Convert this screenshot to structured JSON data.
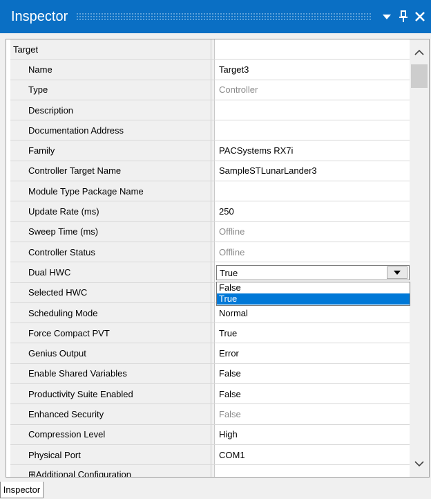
{
  "window": {
    "title": "Inspector",
    "icons": [
      "dropdown-arrow-icon",
      "pin-icon",
      "close-icon"
    ]
  },
  "grid": {
    "category": "Target",
    "rows": [
      {
        "name": "Name",
        "value": "Target3",
        "readonly": false
      },
      {
        "name": "Type",
        "value": "Controller",
        "readonly": true
      },
      {
        "name": "Description",
        "value": "",
        "readonly": false
      },
      {
        "name": "Documentation Address",
        "value": "",
        "readonly": false
      },
      {
        "name": "Family",
        "value": "PACSystems RX7i",
        "readonly": false
      },
      {
        "name": "Controller Target Name",
        "value": "SampleSTLunarLander3",
        "readonly": false
      },
      {
        "name": "Module Type Package Name",
        "value": "",
        "readonly": false
      },
      {
        "name": "Update Rate (ms)",
        "value": "250",
        "readonly": false
      },
      {
        "name": "Sweep Time (ms)",
        "value": "Offline",
        "readonly": true
      },
      {
        "name": "Controller Status",
        "value": "Offline",
        "readonly": true
      },
      {
        "name": "Dual HWC",
        "value": "True",
        "readonly": false,
        "editor": "combo"
      },
      {
        "name": "Selected HWC",
        "value": "",
        "readonly": false
      },
      {
        "name": "Scheduling Mode",
        "value": "Normal",
        "readonly": false
      },
      {
        "name": "Force Compact PVT",
        "value": "True",
        "readonly": false
      },
      {
        "name": "Genius Output",
        "value": "Error",
        "readonly": false
      },
      {
        "name": "Enable Shared Variables",
        "value": "False",
        "readonly": false
      },
      {
        "name": "Productivity Suite Enabled",
        "value": "False",
        "readonly": false
      },
      {
        "name": "Enhanced Security",
        "value": "False",
        "readonly": true
      },
      {
        "name": "Compression Level",
        "value": "High",
        "readonly": false
      },
      {
        "name": "Physical Port",
        "value": "COM1",
        "readonly": false
      },
      {
        "name": "⊞Additional Configuration",
        "value": "",
        "readonly": false
      }
    ]
  },
  "dropdown": {
    "options": [
      "False",
      "True"
    ],
    "selected": "True"
  },
  "bottom_tab": {
    "label": "Inspector"
  },
  "colors": {
    "titlebar": "#0a6fc4",
    "selection": "#0078d7",
    "readonly_text": "#8a8a8a"
  }
}
